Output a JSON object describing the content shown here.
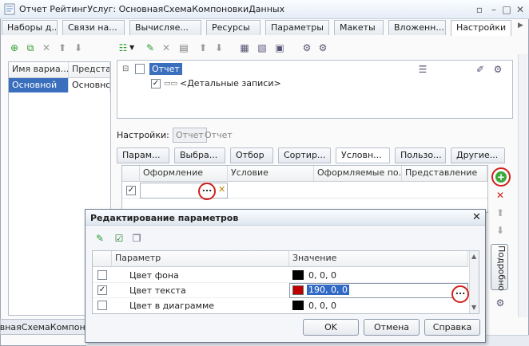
{
  "window": {
    "title": "Отчет РейтингУслуг: ОсновнаяСхемаКомпоновкиДанных"
  },
  "tabs": [
    "Наборы д...",
    "Связи на...",
    "Вычисляе...",
    "Ресурсы",
    "Параметры",
    "Макеты",
    "Вложенн...",
    "Настройки"
  ],
  "variants": {
    "col_name": "Имя вариа...",
    "col_repr": "Представ",
    "row_name": "Основной",
    "row_repr": "Основной"
  },
  "tree": {
    "root": "Отчет",
    "child": "<Детальные записи>"
  },
  "settings": {
    "label": "Настройки:",
    "tag_active": "Отчет",
    "tag_inactive": "Отчет"
  },
  "subtabs": [
    "Парам...",
    "Выбра...",
    "Отбор",
    "Сортир...",
    "Условн...",
    "Пользо...",
    "Другие..."
  ],
  "cond_grid": {
    "headers": [
      "Оформление",
      "Условие",
      "Оформляемые по...",
      "Представление"
    ],
    "ellipsis": "..."
  },
  "side": {
    "podrobno": "Подробно"
  },
  "dialog": {
    "title": "Редактирование параметров",
    "col_param": "Параметр",
    "col_value": "Значение",
    "rows": [
      {
        "name": "Цвет фона",
        "value": "0, 0, 0",
        "color": "#000000",
        "checked": false
      },
      {
        "name": "Цвет текста",
        "value": "190, 0, 0",
        "color": "#be0000",
        "checked": true
      },
      {
        "name": "Цвет в диаграмме",
        "value": "0, 0, 0",
        "color": "#000000",
        "checked": false
      }
    ],
    "ellipsis": "...",
    "ok": "OK",
    "cancel": "Отмена",
    "help": "Справка"
  },
  "status": {
    "text": "овнаяСхемаКомпон."
  },
  "colors": {
    "accent": "#316ac5",
    "red": "#d0201c",
    "selected_row": "#3a6fbd"
  }
}
